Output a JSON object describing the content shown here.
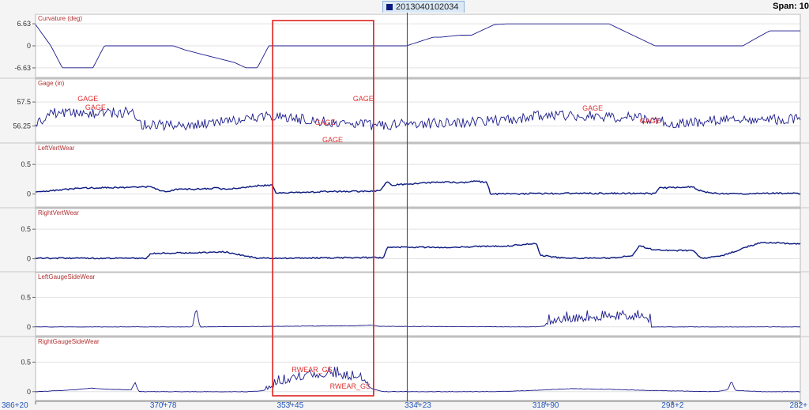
{
  "header": {
    "series_chip": "2013040102034",
    "span_label": "Span: 10"
  },
  "colors": {
    "trace": "#1a1a8c",
    "trace_heavy": "#0b1a80",
    "panel_title": "#b03030",
    "annotation": "#e03030",
    "highlight_box": "#e02020",
    "x_axis_labels": "#2255bb",
    "cursor_line": "#444444"
  },
  "chart_data": [
    {
      "type": "line",
      "title": "Curvature (deg)",
      "yticks": [
        {
          "v": 6.63,
          "label": "6.63"
        },
        {
          "v": 0,
          "label": "0"
        },
        {
          "v": -6.63,
          "label": "-6.63"
        }
      ],
      "ylim": [
        -9.5,
        9.5
      ],
      "noise": 0,
      "seed": 1,
      "x": [
        0,
        2,
        3.5,
        6,
        7.5,
        9,
        10.5,
        16,
        18,
        19.5,
        22,
        26,
        27.5,
        28,
        29,
        30.5,
        37,
        39,
        40,
        46,
        48.5,
        52,
        53,
        55.5,
        57,
        60,
        61.5,
        63.5,
        65,
        68.5,
        70,
        72,
        74,
        75,
        81,
        82,
        83.5,
        90,
        92.5,
        94,
        96,
        98.5,
        100
      ],
      "y": [
        6.4,
        0,
        -6.6,
        -6.6,
        -6.6,
        0,
        0,
        0,
        0,
        -1.2,
        -2.7,
        -5.0,
        -6.6,
        -6.6,
        -6.6,
        0,
        0,
        0,
        0,
        0,
        0,
        2.6,
        2.6,
        3.2,
        3.2,
        6.4,
        6.6,
        6.6,
        6.6,
        6.6,
        6.6,
        6.6,
        6.6,
        6.6,
        0,
        0,
        0,
        0,
        0,
        2.0,
        4.5,
        4.5,
        4.5
      ]
    },
    {
      "type": "line",
      "title": "Gage (in)",
      "yticks": [
        {
          "v": 57.5,
          "label": "57.5"
        },
        {
          "v": 56.25,
          "label": "56.25"
        }
      ],
      "ylim": [
        55.4,
        58.7
      ],
      "noise": 0.55,
      "seed": 2,
      "x": [
        0,
        2,
        8,
        12.5,
        14,
        18,
        20,
        27,
        30,
        40,
        44,
        52,
        60,
        66,
        70,
        78,
        81,
        84,
        92,
        100
      ],
      "y": [
        56.3,
        56.9,
        56.9,
        57.0,
        56.3,
        56.3,
        56.3,
        56.6,
        56.8,
        56.4,
        56.3,
        56.4,
        56.5,
        56.8,
        56.8,
        56.7,
        56.5,
        56.4,
        56.6,
        56.6
      ],
      "annotations": [
        {
          "x": 5.5,
          "y": 57.55,
          "text": "GAGE"
        },
        {
          "x": 6.5,
          "y": 57.1,
          "text": "GAGE"
        },
        {
          "x": 36.5,
          "y": 56.3,
          "text": "GAGE"
        },
        {
          "x": 37.5,
          "y": 55.4,
          "text": "GAGE"
        },
        {
          "x": 41.5,
          "y": 57.55,
          "text": "GAGE"
        },
        {
          "x": 71.5,
          "y": 57.05,
          "text": "GAGE"
        },
        {
          "x": 79,
          "y": 56.4,
          "text": "GAGE"
        }
      ]
    },
    {
      "type": "line",
      "title": "LeftVertWear",
      "yticks": [
        {
          "v": 0.5,
          "label": "0.5"
        },
        {
          "v": 0,
          "label": "0"
        }
      ],
      "ylim": [
        -0.22,
        0.85
      ],
      "noise": 0.025,
      "seed": 3,
      "x": [
        0,
        1,
        6,
        15,
        17,
        18.5,
        21,
        23.5,
        25,
        29,
        31,
        31.5,
        32,
        38,
        45,
        46,
        46.5,
        49,
        53,
        56,
        57,
        59,
        59.5,
        60,
        69,
        80,
        81,
        81.5,
        86,
        86.5,
        88,
        90,
        95,
        100
      ],
      "y": [
        0.03,
        0.04,
        0.1,
        0.12,
        0.03,
        0.08,
        0.08,
        0.1,
        0.08,
        0.14,
        0.15,
        0.01,
        0.02,
        0.04,
        0.05,
        0.22,
        0.15,
        0.17,
        0.2,
        0.19,
        0.22,
        0.2,
        0.0,
        0.0,
        0.01,
        0.01,
        0.0,
        0.1,
        0.12,
        0.07,
        0.02,
        0.0,
        0.01,
        0.01
      ]
    },
    {
      "type": "line",
      "title": "RightVertWear",
      "yticks": [
        {
          "v": 0.5,
          "label": "0.5"
        },
        {
          "v": 0,
          "label": "0"
        }
      ],
      "ylim": [
        -0.22,
        0.85
      ],
      "noise": 0.022,
      "seed": 4,
      "x": [
        0,
        14.5,
        15,
        23,
        24.5,
        29,
        31,
        44,
        45.5,
        46,
        53,
        62,
        65.5,
        66,
        66.5,
        69,
        75,
        78,
        79,
        80.5,
        82,
        86,
        87,
        88,
        90,
        93,
        95,
        100
      ],
      "y": [
        0.01,
        0.01,
        0.09,
        0.11,
        0.12,
        0.01,
        0.01,
        0.02,
        0.02,
        0.2,
        0.19,
        0.22,
        0.26,
        0.05,
        0.05,
        0.01,
        0.01,
        0.05,
        0.22,
        0.16,
        0.14,
        0.14,
        0.01,
        0.02,
        0.06,
        0.2,
        0.28,
        0.25
      ]
    },
    {
      "type": "line",
      "title": "LeftGaugeSideWear",
      "yticks": [
        {
          "v": 0.5,
          "label": "0.5"
        },
        {
          "v": 0,
          "label": "0"
        }
      ],
      "ylim": [
        -0.15,
        0.92
      ],
      "noise": 0.006,
      "seed": 5,
      "x": [
        0,
        20.5,
        21,
        21.5,
        42,
        44,
        45,
        65,
        66.5,
        67,
        70,
        76,
        80,
        80.5,
        81,
        100
      ],
      "y": [
        0.0,
        0.0,
        0.32,
        0.0,
        0.02,
        0.03,
        0.01,
        0.0,
        0.01,
        0.04,
        0.08,
        0.12,
        0.1,
        0.0,
        0.0,
        0.0
      ],
      "bursts": [
        {
          "from": 66.5,
          "to": 80.5,
          "amp": 0.2,
          "seed": 15
        }
      ]
    },
    {
      "type": "line",
      "title": "RightGaugeSideWear",
      "yticks": [
        {
          "v": 0.5,
          "label": "0.5"
        },
        {
          "v": 0,
          "label": "0"
        }
      ],
      "ylim": [
        -0.15,
        0.92
      ],
      "noise": 0.007,
      "seed": 6,
      "x": [
        0,
        5,
        7,
        9.5,
        12.5,
        13,
        13.5,
        28,
        30,
        31.5,
        33,
        36,
        38,
        40,
        42.5,
        44,
        45.5,
        48,
        60,
        65,
        70,
        75,
        80,
        89,
        90.5,
        91,
        91.5,
        95,
        100
      ],
      "y": [
        0.0,
        0.03,
        0.06,
        0.04,
        0.03,
        0.16,
        0.0,
        0.0,
        0.02,
        0.08,
        0.15,
        0.22,
        0.25,
        0.22,
        0.18,
        0.05,
        0.0,
        0.0,
        0.0,
        0.02,
        0.05,
        0.04,
        0.02,
        0.0,
        0.03,
        0.18,
        0.02,
        0.0,
        0.0
      ],
      "bursts": [
        {
          "from": 30,
          "to": 43.5,
          "amp": 0.22,
          "seed": 16
        }
      ],
      "annotations": [
        {
          "x": 33.5,
          "y": 0.33,
          "text": "RWEAR_GS"
        },
        {
          "x": 38.5,
          "y": 0.05,
          "text": "RWEAR_GS"
        }
      ]
    }
  ],
  "x_axis": {
    "xlim": [
      0,
      100
    ],
    "ticks": [
      {
        "v": 0,
        "label": "386+20"
      },
      {
        "v": 16.7,
        "label": "370+78"
      },
      {
        "v": 33.3,
        "label": "353+45"
      },
      {
        "v": 50,
        "label": "334+23"
      },
      {
        "v": 66.7,
        "label": "318+90"
      },
      {
        "v": 83.3,
        "label": "298+2"
      },
      {
        "v": 100,
        "label": "282+"
      }
    ]
  },
  "highlight_range": {
    "x_from": 31,
    "x_to": 44.2
  },
  "cursor_x": 48.6
}
